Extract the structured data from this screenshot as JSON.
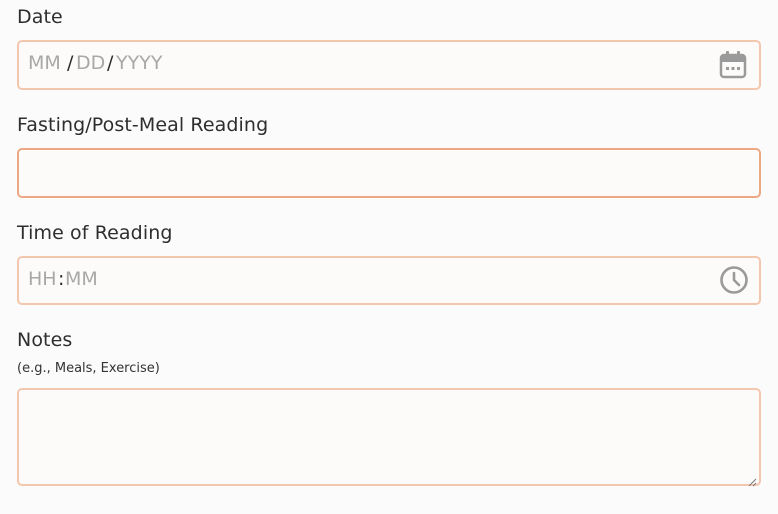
{
  "form": {
    "date": {
      "label": "Date",
      "month_placeholder": "MM",
      "separator1": "/",
      "day_placeholder": "DD",
      "separator2": "/",
      "year_placeholder": "YYYY",
      "icon": "calendar-icon"
    },
    "reading": {
      "label": "Fasting/Post-Meal Reading",
      "value": ""
    },
    "time": {
      "label": "Time of Reading",
      "hour_placeholder": "HH",
      "separator": ":",
      "minute_placeholder": "MM",
      "icon": "clock-icon"
    },
    "notes": {
      "label": "Notes",
      "sublabel": "(e.g., Meals, Exercise)",
      "value": ""
    }
  },
  "colors": {
    "field_border": "#f3c7ad",
    "field_border_focused": "#eca884",
    "placeholder_text": "#a8a8a8",
    "icon": "#9a9a9a"
  }
}
